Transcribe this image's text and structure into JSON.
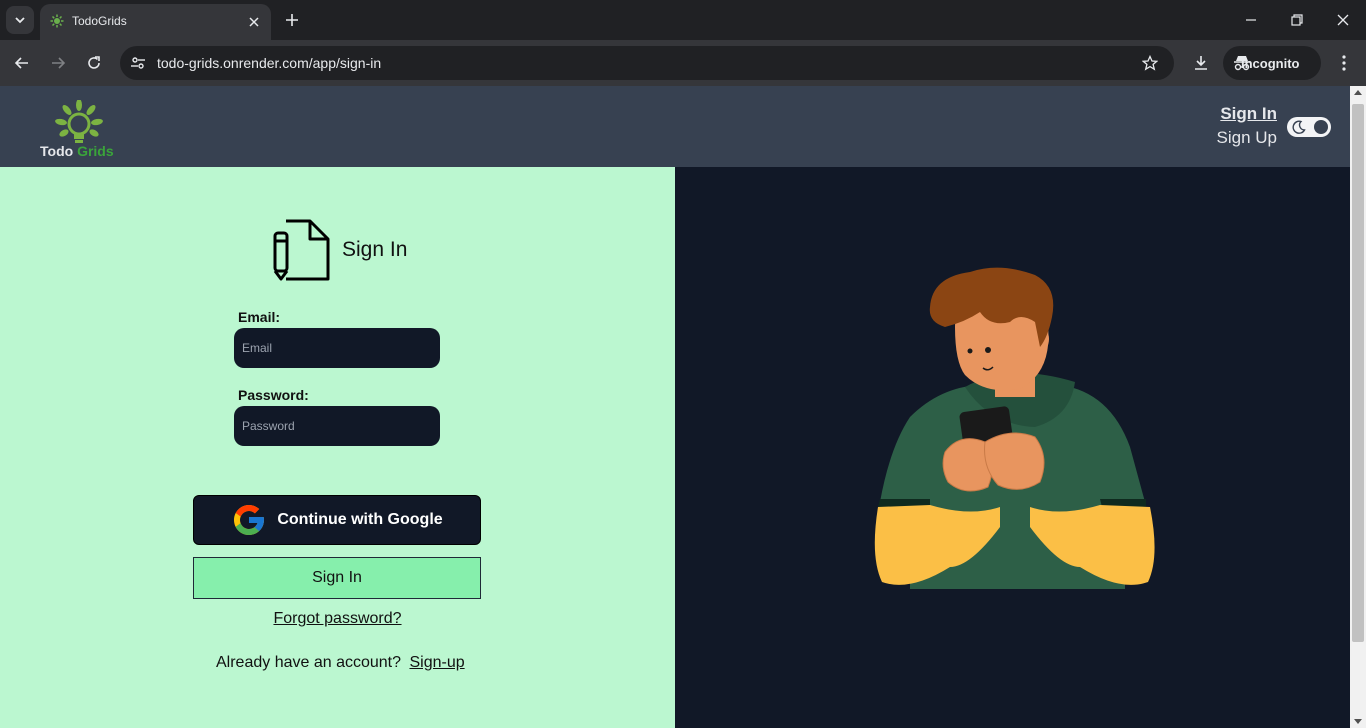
{
  "browser": {
    "tab_title": "TodoGrids",
    "url": "todo-grids.onrender.com/app/sign-in",
    "incognito_label": "Incognito"
  },
  "header": {
    "logo_word1": "Todo",
    "logo_word2": "Grids",
    "sign_in_link": "Sign In",
    "sign_up_link": "Sign Up",
    "theme_toggle_on": true
  },
  "form": {
    "title": "Sign In",
    "email_label": "Email:",
    "email_placeholder": "Email",
    "email_value": "",
    "password_label": "Password:",
    "password_placeholder": "Password",
    "password_value": "",
    "google_button": "Continue with Google",
    "sign_in_button": "Sign In",
    "forgot_password": "Forgot password?",
    "already_text": "Already have an account?",
    "signup_link": "Sign-up"
  },
  "colors": {
    "header_bg": "#374151",
    "left_pane_bg": "#bbf7d0",
    "dark_bg": "#111827",
    "sign_in_button_bg": "#86efac"
  }
}
